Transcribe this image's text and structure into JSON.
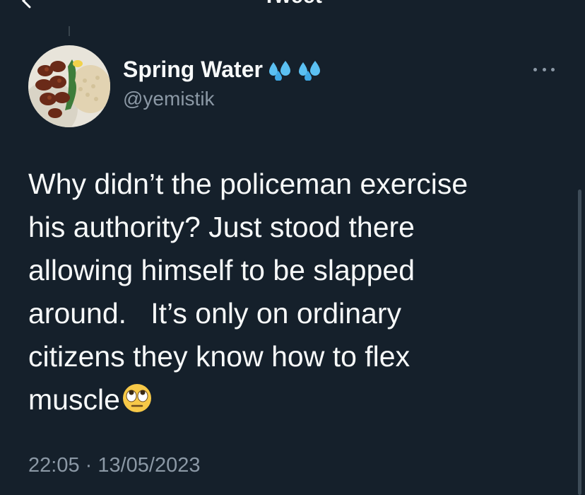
{
  "header": {
    "title": "Tweet"
  },
  "author": {
    "display_name": "Spring Water",
    "handle": "@yemistik",
    "name_icons": [
      "sweat-droplets-icon",
      "sweat-droplets-icon"
    ]
  },
  "tweet": {
    "text": "Why didn’t the policeman exercise\nhis authority? Just stood there\nallowing himself to be slapped\naround.   It’s only on ordinary\ncitizens they know how to flex\nmuscle",
    "emoji": "face-with-rolling-eyes-icon",
    "timestamp": "22:05 · 13/05/2023"
  },
  "colors": {
    "background": "#15202b",
    "text_primary": "#f7f9f9",
    "text_secondary": "#8b98a5",
    "divider": "#38444d"
  }
}
